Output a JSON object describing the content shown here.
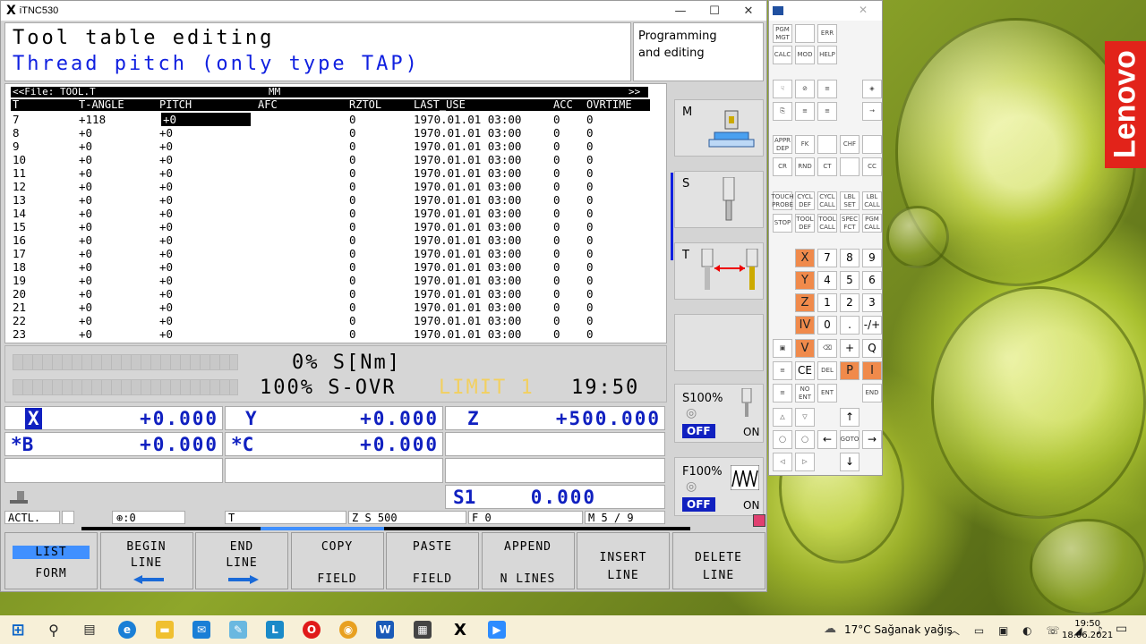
{
  "window": {
    "logo": "X",
    "title": "iTNC530",
    "controls": [
      "—",
      "☐",
      "✕"
    ]
  },
  "header": {
    "line1": "Tool table editing",
    "line2": "Thread pitch (only type TAP)",
    "mode": "Programming\nand editing"
  },
  "table": {
    "file": "<<File: TOOL.T",
    "unit": "MM",
    "more": ">>",
    "columns": [
      "T",
      "T-ANGLE",
      "PITCH",
      "AFC",
      "RZTOL",
      "LAST_USE",
      "ACC",
      "OVRTIME"
    ],
    "rows": [
      [
        "7",
        "+118",
        "+0",
        "",
        "0",
        "1970.01.01 03:00",
        "0",
        "0"
      ],
      [
        "8",
        "+0",
        "+0",
        "",
        "0",
        "1970.01.01 03:00",
        "0",
        "0"
      ],
      [
        "9",
        "+0",
        "+0",
        "",
        "0",
        "1970.01.01 03:00",
        "0",
        "0"
      ],
      [
        "10",
        "+0",
        "+0",
        "",
        "0",
        "1970.01.01 03:00",
        "0",
        "0"
      ],
      [
        "11",
        "+0",
        "+0",
        "",
        "0",
        "1970.01.01 03:00",
        "0",
        "0"
      ],
      [
        "12",
        "+0",
        "+0",
        "",
        "0",
        "1970.01.01 03:00",
        "0",
        "0"
      ],
      [
        "13",
        "+0",
        "+0",
        "",
        "0",
        "1970.01.01 03:00",
        "0",
        "0"
      ],
      [
        "14",
        "+0",
        "+0",
        "",
        "0",
        "1970.01.01 03:00",
        "0",
        "0"
      ],
      [
        "15",
        "+0",
        "+0",
        "",
        "0",
        "1970.01.01 03:00",
        "0",
        "0"
      ],
      [
        "16",
        "+0",
        "+0",
        "",
        "0",
        "1970.01.01 03:00",
        "0",
        "0"
      ],
      [
        "17",
        "+0",
        "+0",
        "",
        "0",
        "1970.01.01 03:00",
        "0",
        "0"
      ],
      [
        "18",
        "+0",
        "+0",
        "",
        "0",
        "1970.01.01 03:00",
        "0",
        "0"
      ],
      [
        "19",
        "+0",
        "+0",
        "",
        "0",
        "1970.01.01 03:00",
        "0",
        "0"
      ],
      [
        "20",
        "+0",
        "+0",
        "",
        "0",
        "1970.01.01 03:00",
        "0",
        "0"
      ],
      [
        "21",
        "+0",
        "+0",
        "",
        "0",
        "1970.01.01 03:00",
        "0",
        "0"
      ],
      [
        "22",
        "+0",
        "+0",
        "",
        "0",
        "1970.01.01 03:00",
        "0",
        "0"
      ],
      [
        "23",
        "+0",
        "+0",
        "",
        "0",
        "1970.01.01 03:00",
        "0",
        "0"
      ]
    ]
  },
  "status": {
    "torque": "0% S[Nm]",
    "override_pct": "100% S-OVR",
    "limit": "LIMIT 1",
    "time": "19:50"
  },
  "axes": {
    "x": {
      "label": "X",
      "value": "+0.000"
    },
    "y": {
      "label": "Y",
      "value": "+0.000"
    },
    "z": {
      "label": "Z",
      "value": "+500.000"
    },
    "b": {
      "label": "*B",
      "value": "+0.000"
    },
    "c": {
      "label": "*C",
      "value": "+0.000"
    }
  },
  "spindle": {
    "label": "S1",
    "value": "0.000"
  },
  "infobar": {
    "mode": "ACTL.",
    "datum": ":0",
    "tool": "T",
    "axis": "Z",
    "speed": "S 500",
    "feed": "F 0",
    "mcode": "M 5 / 9"
  },
  "right_panel": {
    "m_label": "M",
    "s_label": "S",
    "t_label": "T",
    "s_override": "S100%",
    "f_override": "F100%",
    "off": "OFF",
    "on": "ON"
  },
  "softkeys": [
    {
      "l1": "LIST",
      "l2": "FORM"
    },
    {
      "l1": "BEGIN",
      "l2": "LINE"
    },
    {
      "l1": "END",
      "l2": "LINE"
    },
    {
      "l1": "COPY",
      "l2": "FIELD"
    },
    {
      "l1": "PASTE",
      "l2": "FIELD"
    },
    {
      "l1": "APPEND",
      "l2": "N LINES"
    },
    {
      "l1": "INSERT",
      "l2": "LINE"
    },
    {
      "l1": "DELETE",
      "l2": "LINE"
    }
  ],
  "keypad": {
    "top": [
      "PGM MGT",
      "",
      "ERR",
      "CALC",
      "MOD",
      "HELP"
    ],
    "prog": [
      "APPR DEP",
      "FK",
      "",
      "CHF",
      "",
      "CR",
      "RND",
      "CT",
      "",
      "CC",
      "",
      "TOUCH PROBE",
      "CYCL DEF",
      "CYCL CALL",
      "LBL SET",
      "LBL CALL",
      "STOP",
      "TOOL DEF",
      "TOOL CALL",
      "SPEC FCT",
      "PGM CALL"
    ],
    "axes": [
      "X",
      "Y",
      "Z",
      "IV",
      "V"
    ],
    "digits": [
      "7",
      "8",
      "9",
      "4",
      "5",
      "6",
      "1",
      "2",
      "3",
      "0",
      ".",
      "-/+"
    ],
    "misc": [
      "CE",
      "DEL",
      "P",
      "I",
      "NO ENT",
      "ENT",
      "END",
      "GOTO",
      "Q"
    ]
  },
  "taskbar": {
    "weather": "17°C Sağanak yağış",
    "time": "19:50",
    "date": "18.06.2021"
  }
}
